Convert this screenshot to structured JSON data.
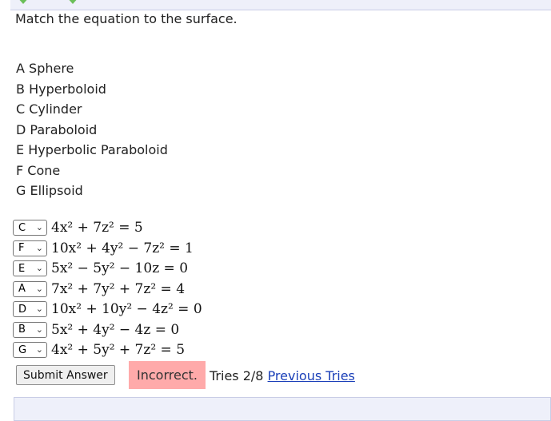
{
  "prompt": "Match the equation to the surface.",
  "choices": [
    "A Sphere",
    "B Hyperboloid",
    "C Cylinder",
    "D Paraboloid",
    "E Hyperbolic Paraboloid",
    "F Cone",
    "G Ellipsoid"
  ],
  "rows": [
    {
      "selected": "C",
      "equation": "4x² + 7z² = 5"
    },
    {
      "selected": "F",
      "equation": "10x² + 4y² − 7z² = 1"
    },
    {
      "selected": "E",
      "equation": "5x² − 5y² − 10z = 0"
    },
    {
      "selected": "A",
      "equation": "7x² + 7y² + 7z² = 4"
    },
    {
      "selected": "D",
      "equation": "10x² + 10y² − 4z² = 0"
    },
    {
      "selected": "B",
      "equation": "5x² + 4y² − 4z = 0"
    },
    {
      "selected": "G",
      "equation": "4x² + 5y² + 7z² = 5"
    }
  ],
  "submit_label": "Submit Answer",
  "status": "Incorrect.",
  "tries_text": "Tries 2/8",
  "previous_tries_label": "Previous Tries",
  "colors": {
    "incorrect_bg": "#ffaaaa",
    "link": "#1a3fb8",
    "panel_bg": "#eef0fa"
  }
}
